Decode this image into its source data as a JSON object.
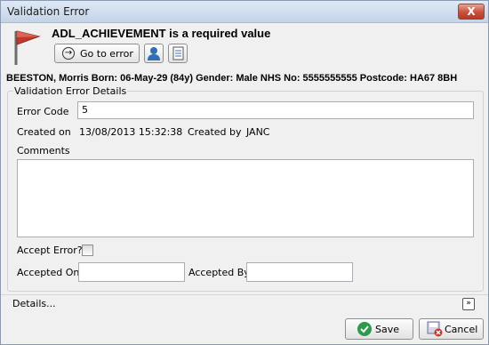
{
  "window": {
    "title": "Validation Error",
    "close_glyph": "X"
  },
  "header": {
    "message": "ADL_ACHIEVEMENT is a required value",
    "icons": [
      "flag-icon",
      "person-icon",
      "document-icon"
    ]
  },
  "toolbar": {
    "goto_label": "Go to error",
    "goto_icon": "arrow-right-circle-icon"
  },
  "patient": {
    "summary": "BEESTON, Morris   Born: 06-May-29 (84y)  Gender: Male  NHS No: 5555555555  Postcode: HA67 8BH"
  },
  "validation": {
    "group_title": "Validation Error Details",
    "error_code_label": "Error Code",
    "error_code_value": "5",
    "created_on_label": "Created on",
    "created_on_value": "13/08/2013 15:32:38",
    "created_by_label": "Created by",
    "created_by_value": "JANC",
    "comments_label": "Comments",
    "accept_error_label": "Accept Error?",
    "accepted_on_label": "Accepted On",
    "accepted_by_label": "Accepted By"
  },
  "details": {
    "label": "Details...",
    "expand_glyph": "»"
  },
  "footer": {
    "save_label": "Save",
    "cancel_label": "Cancel"
  },
  "colors": {
    "flag": "#c0392b",
    "save_icon": "#2e9a4c",
    "cancel_icon": "#c0392b"
  }
}
